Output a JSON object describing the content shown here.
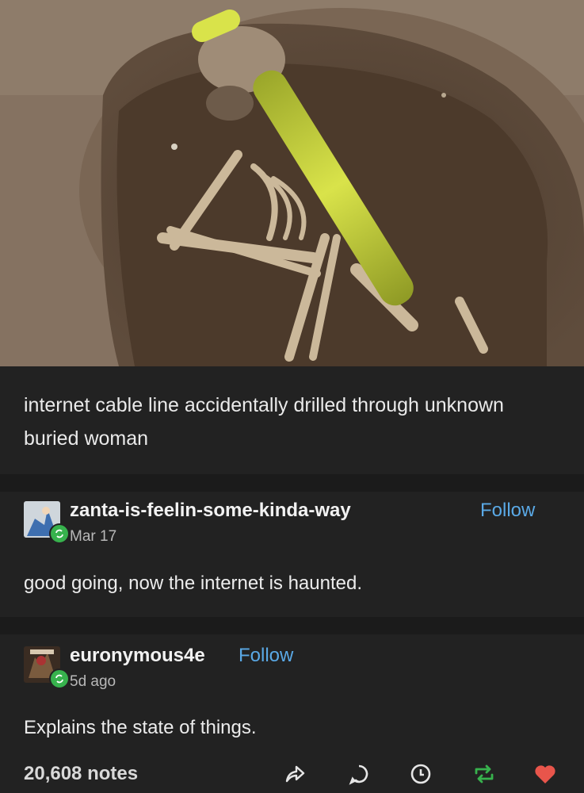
{
  "post": {
    "caption": "internet cable line accidentally drilled through unknown buried woman"
  },
  "reblogs": [
    {
      "username": "zanta-is-feelin-some-kinda-way",
      "follow_label": "Follow",
      "date": "Mar 17",
      "text": "good going, now the internet is haunted."
    },
    {
      "username": "euronymous4e",
      "follow_label": "Follow",
      "date": "5d ago",
      "text": "Explains the state of things."
    }
  ],
  "footer": {
    "notes": "20,608 notes"
  },
  "colors": {
    "background": "#222222",
    "follow": "#5aa9e6",
    "reblog_badge": "#37b24d",
    "like": "#e8554b",
    "reblog_icon": "#37b24d"
  }
}
